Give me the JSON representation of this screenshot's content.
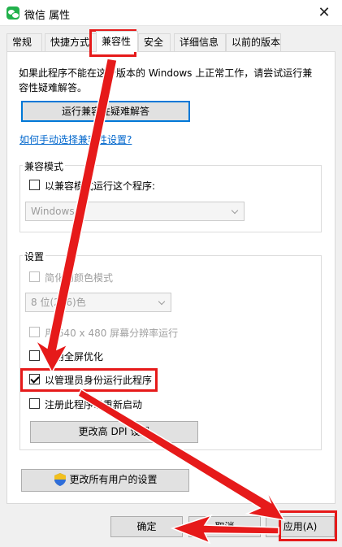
{
  "window": {
    "title": "微信 属性",
    "close_glyph": "✕"
  },
  "tabs": [
    {
      "label": "常规"
    },
    {
      "label": "快捷方式"
    },
    {
      "label": "兼容性"
    },
    {
      "label": "安全"
    },
    {
      "label": "详细信息"
    },
    {
      "label": "以前的版本"
    }
  ],
  "intro": {
    "text": "如果此程序不能在这个版本的 Windows 上正常工作，请尝试运行兼容性疑难解答。"
  },
  "troubleshoot_button": "运行兼容性疑难解答",
  "manual_link": "如何手动选择兼容性设置?",
  "compat_mode": {
    "group_label": "兼容模式",
    "checkbox_label": "以兼容模式运行这个程序:",
    "checked": false,
    "select_value": "Windows 8"
  },
  "settings": {
    "group_label": "设置",
    "reduced_color": "简化的颜色模式",
    "color_select": "8 位(256)色",
    "res_640": "用 640 x 480 屏幕分辨率运行",
    "disable_fullscreen": "禁用全屏优化",
    "run_as_admin": "以管理员身份运行此程序",
    "run_as_admin_checked": true,
    "register_restart": "注册此程序以重新启动",
    "dpi_button": "更改高 DPI 设置"
  },
  "all_users_button": "更改所有用户的设置",
  "footer": {
    "ok": "确定",
    "cancel": "取消",
    "apply": "应用(A)"
  },
  "colors": {
    "highlight": "#e61a1a",
    "link": "#0066cc",
    "focus": "#0078d7"
  },
  "icons": [
    "wechat-app-icon",
    "close-icon",
    "uac-shield-icon",
    "chevron-down-icon"
  ]
}
